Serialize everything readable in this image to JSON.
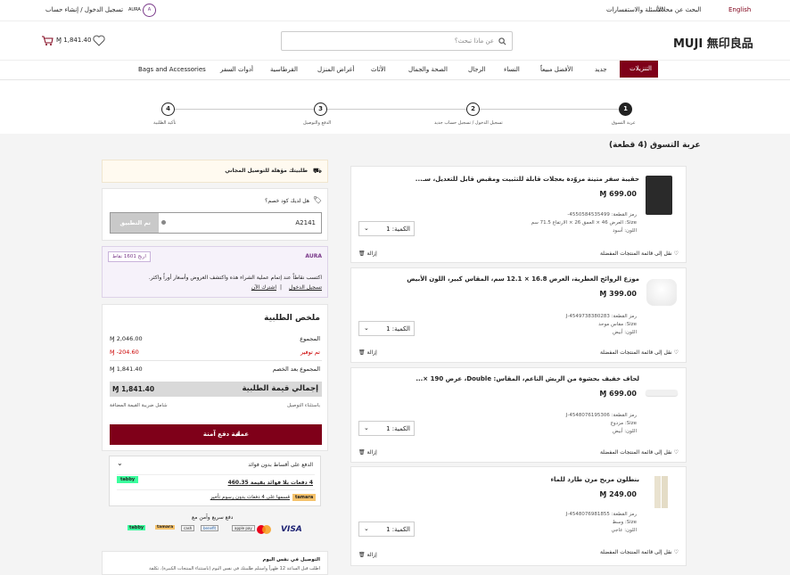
{
  "topbar": {
    "english": "English",
    "search_stores": "البحث عن محلاتنا",
    "faq": "الأسئلة والاستفسارات",
    "login_register": "تسجيل الدخول / إنشاء حساب",
    "aura": "AURA"
  },
  "header": {
    "logo": "MUJI 無印良品",
    "search_placeholder": "عن ماذا تبحث؟",
    "cart_total": "1,841.40"
  },
  "nav": {
    "items": [
      "التنزيلات",
      "جديد",
      "الأفضل مبيعاً",
      "النساء",
      "الرجال",
      "الصحة والجمال",
      "الأثاث",
      "أغراض المنزل",
      "القرطاسية",
      "أدوات السفر",
      "Bags and Accessories"
    ]
  },
  "steps": [
    {
      "num": "1",
      "label": "عربة التسوق"
    },
    {
      "num": "2",
      "label": "تسجيل الدخول / تسجيل حساب جديد"
    },
    {
      "num": "3",
      "label": "الدفع والتوصيل"
    },
    {
      "num": "4",
      "label": "تأكيد الطلبية"
    }
  ],
  "cart_title": "عربة التسوق (4 قطعة)",
  "products": [
    {
      "name": "حقيبة سفر متينة مزوّدة بعجلات قابلة للتثبيت ومقبض قابل للتعديل، سـ...",
      "price": "699.00",
      "sku": "رمز القطعة: 4550584535499-",
      "size": "Size: العرض 46 × العمق 26 × الارتفاع 71.5 سم",
      "color": "اللون: أسود",
      "qty": "الكمية: 1",
      "wishlist": "نقل إلى قائمة المنتجات المفضلة",
      "remove": "إزالة"
    },
    {
      "name": "موزع الروائح العطرية، العرض 16.8 × 12.1 سم، المقاس كبير، اللون الأبيض",
      "price": "399.00",
      "sku": "رمز القطعة: 4549738380283-J",
      "size": "Size: مقاس موحد",
      "color": "اللون: أبيض",
      "qty": "الكمية: 1",
      "wishlist": "نقل إلى قائمة المنتجات المفضلة",
      "remove": "إزالة"
    },
    {
      "name": "لحاف خفيف بحشوة من الريش الناعم، المقاس: Double، عرض 190 ×...",
      "price": "699.00",
      "sku": "رمز القطعة: 4548076195306-J",
      "size": "Size: مزدوج",
      "color": "اللون: أبيض",
      "qty": "الكمية: 1",
      "wishlist": "نقل إلى قائمة المنتجات المفضلة",
      "remove": "إزالة"
    },
    {
      "name": "بنطلون مريح مرن طارد للماء",
      "price": "249.00",
      "sku": "رمز القطعة: 4548076981855-J",
      "size": "Size: وسط",
      "color": "اللون: عاجي",
      "qty": "الكمية: 1",
      "wishlist": "نقل إلى قائمة المنتجات المفضلة",
      "remove": "إزالة"
    }
  ],
  "free_shipping": "طلبيتك مؤهلة للتوصيل المجاني",
  "coupon": {
    "question": "هل لديك كود خصم؟",
    "value": "A2141",
    "apply": "تم التطبيق"
  },
  "aura_box": {
    "logo": "AURA",
    "points": "اربح 1601 نقاط",
    "text": "اكتسب نقاطاً عند إتمام عملية الشراء هذه واكتشف العروض وأسعار أوراً واكثر.",
    "login": "تسجيل الدخول",
    "sep": "|",
    "join": "اشترك الآن"
  },
  "summary": {
    "title": "ملخص الطلبية",
    "subtotal_label": "المجموع",
    "subtotal": "2,046.00",
    "saved_label": "تم توفير",
    "saved": "-204.60",
    "after_discount_label": "المجموع بعد الخصم",
    "after_discount": "1,841.40",
    "total_label": "إجمالي قيمة الطلبية",
    "total": "1,841.40",
    "excl_delivery": "باستثناء التوصيل",
    "incl_vat": "شامل ضريبة القيمة المضافة",
    "checkout": "عملية دفع آمنة"
  },
  "installments": {
    "title": "الدفع على أقساط بدون فوائد",
    "tabby_logo": "tabby",
    "tabby_text": "4 دفعات بلا فوائد بقيمة 460.35",
    "tamara_logo": "tamara",
    "tamara_text": "قسمها على 4 دفعات بدون رسوم تأخير"
  },
  "pay_title": "دفع سريع وآمن مع",
  "pay_methods": [
    "VISA",
    "mastercard",
    "apple pay",
    "benefit",
    "cash",
    "tamara",
    "tabby"
  ],
  "same_day": {
    "title": "التوصيل في نفس اليوم",
    "text": "اطلب قبل الساعة 12 ظهراً واستلم طلبيتك في نفس اليوم (باستثناء المنتجات الكبيرة). تكلفة"
  },
  "colors": {
    "brand": "#7f0019",
    "tabby": "#3bff9d",
    "tamara": "#f5c26b"
  }
}
